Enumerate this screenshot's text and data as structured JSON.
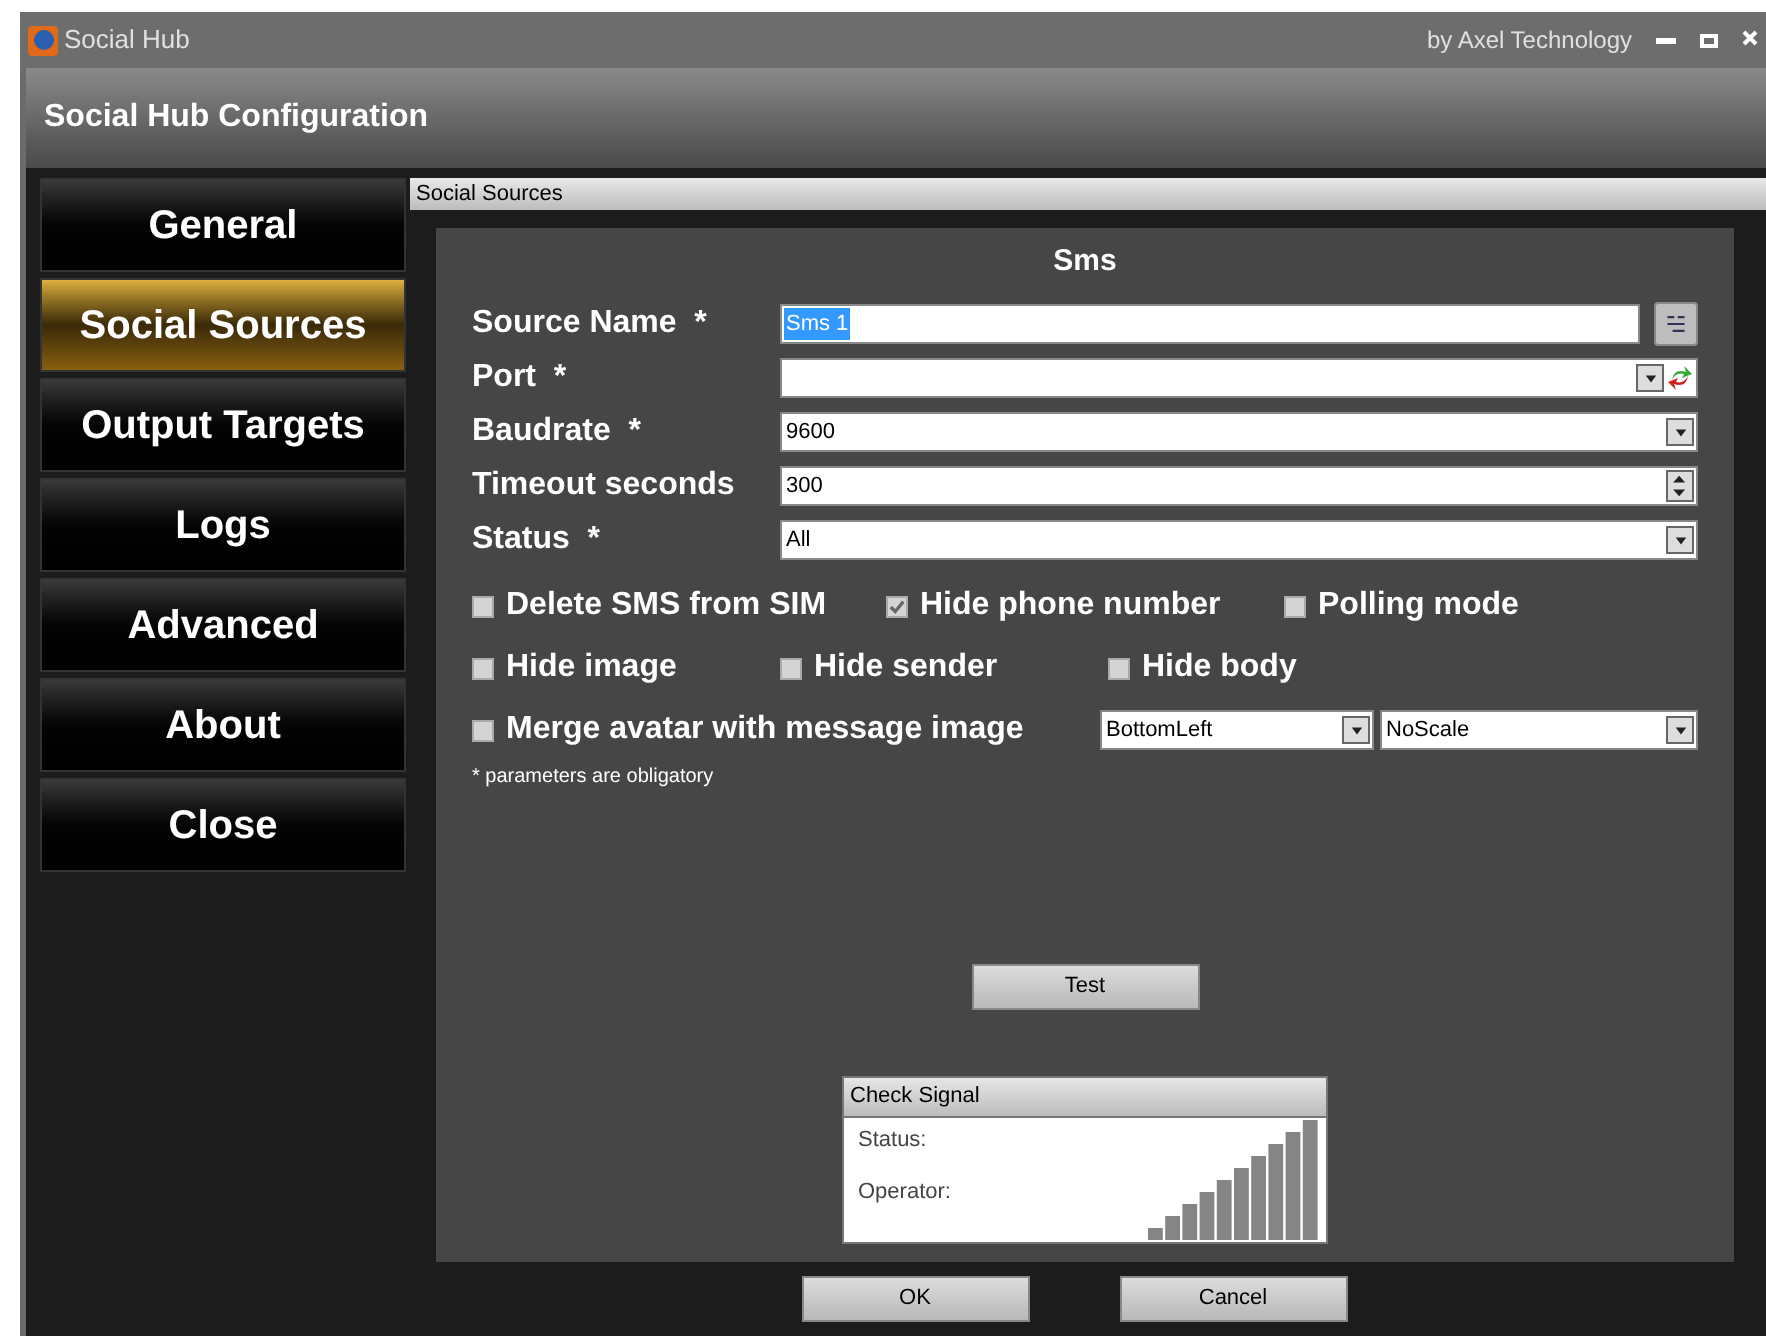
{
  "window": {
    "title": "Social Hub",
    "vendor": "by Axel Technology"
  },
  "header": {
    "title": "Social Hub Configuration"
  },
  "sidebar": {
    "items": [
      {
        "label": "General",
        "selected": false
      },
      {
        "label": "Social Sources",
        "selected": true
      },
      {
        "label": "Output Targets",
        "selected": false
      },
      {
        "label": "Logs",
        "selected": false
      },
      {
        "label": "Advanced",
        "selected": false
      },
      {
        "label": "About",
        "selected": false
      },
      {
        "label": "Close",
        "selected": false
      }
    ]
  },
  "panel": {
    "title": "Social Sources",
    "section": "Sms",
    "fields": [
      {
        "label": "Source Name",
        "required": "*",
        "kind": "text",
        "value": "Sms 1",
        "selected": true
      },
      {
        "label": "Port",
        "required": "*",
        "kind": "port",
        "selected": false
      },
      {
        "label": "Baudrate",
        "required": "*",
        "kind": "dropdown",
        "value": "9600",
        "selected": false
      },
      {
        "label": "Timeout seconds",
        "kind": "spinner",
        "value": "300",
        "selected": false
      },
      {
        "label": "Status",
        "required": "*",
        "kind": "dropdown",
        "value": "All",
        "selected": false
      }
    ],
    "option_rows": [
      [
        {
          "label": "Delete SMS from SIM",
          "checked": false
        },
        {
          "label": "Hide phone number",
          "checked": true
        },
        {
          "label": "Polling mode",
          "checked": false
        }
      ],
      [
        {
          "label": "Hide image",
          "checked": false
        },
        {
          "label": "Hide sender",
          "checked": false
        },
        {
          "label": "Hide body",
          "checked": false
        }
      ]
    ],
    "merge": {
      "label": "Merge avatar with message image",
      "checked": false,
      "position": "BottomLeft",
      "scale": "NoScale"
    },
    "note": "* parameters are obligatory",
    "test_button": "Test",
    "check_signal": {
      "title": "Check Signal",
      "status_label": "Status:",
      "operator_label": "Operator:"
    }
  },
  "buttons": [
    "OK",
    "Cancel"
  ]
}
